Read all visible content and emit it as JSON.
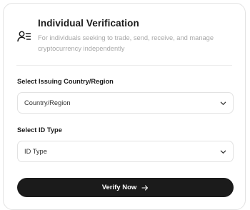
{
  "header": {
    "title": "Individual Verification",
    "subtitle": "For individuals seeking to trade, send, receive, and manage cryptocurrency independently",
    "icon": "person-list-icon"
  },
  "country_field": {
    "label": "Select Issuing Country/Region",
    "value": "Country/Region",
    "icon": "chevron-down-icon"
  },
  "id_type_field": {
    "label": "Select ID Type",
    "value": "ID Type",
    "icon": "chevron-down-icon"
  },
  "verify_button": {
    "label": "Verify Now",
    "icon": "arrow-right-icon"
  },
  "colors": {
    "primary_button": "#1b1b1b",
    "muted_text": "#a8a8a8",
    "border": "#e2e2e2"
  }
}
